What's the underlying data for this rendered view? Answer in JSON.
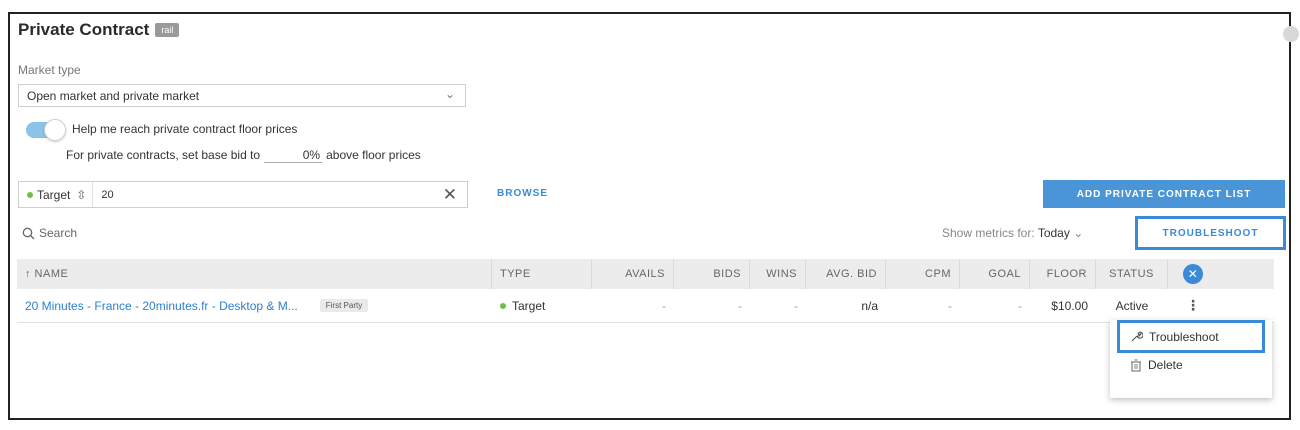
{
  "panel": {
    "title": "Private Contract",
    "title_badge": "rail"
  },
  "market_type": {
    "label": "Market type",
    "selected": "Open market and private market"
  },
  "floor_toggle": {
    "label": "Help me reach private contract floor prices",
    "enabled": true
  },
  "base_bid": {
    "prefix": "For private contracts, set base bid to",
    "value": "0%",
    "suffix": "above floor prices"
  },
  "target_filter": {
    "type_label": "Target",
    "value": "20"
  },
  "browse_label": "BROWSE",
  "add_button_label": "ADD PRIVATE CONTRACT LIST",
  "search_placeholder": "Search",
  "metrics": {
    "label": "Show metrics for:",
    "value": "Today"
  },
  "troubleshoot_button_label": "TROUBLESHOOT",
  "table": {
    "headers": {
      "name": "↑ NAME",
      "type": "TYPE",
      "avails": "AVAILS",
      "bids": "BIDS",
      "wins": "WINS",
      "avg_bid": "AVG. BID",
      "cpm": "CPM",
      "goal": "GOAL",
      "floor": "FLOOR",
      "status": "STATUS"
    },
    "rows": [
      {
        "name": "20 Minutes - France - 20minutes.fr - Desktop & M...",
        "badge": "First Party",
        "type": "Target",
        "avails": "-",
        "bids": "-",
        "wins": "-",
        "avg_bid": "n/a",
        "cpm": "-",
        "goal": "-",
        "floor": "$10.00",
        "status": "Active"
      }
    ]
  },
  "row_menu": {
    "troubleshoot": "Troubleshoot",
    "delete": "Delete"
  },
  "colors": {
    "accent": "#3b8ad8",
    "target_dot": "#6cbf4a"
  }
}
